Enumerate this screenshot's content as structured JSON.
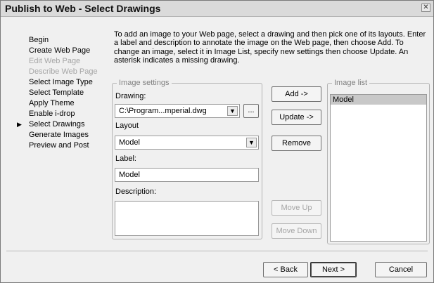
{
  "window": {
    "title": "Publish to Web - Select Drawings",
    "close_glyph": "✕"
  },
  "nav": {
    "current_marker": "▶",
    "items": [
      {
        "label": "Begin",
        "state": "enabled"
      },
      {
        "label": "Create Web Page",
        "state": "enabled"
      },
      {
        "label": "Edit Web Page",
        "state": "disabled"
      },
      {
        "label": "Describe Web Page",
        "state": "disabled"
      },
      {
        "label": "Select Image Type",
        "state": "enabled"
      },
      {
        "label": "Select Template",
        "state": "enabled"
      },
      {
        "label": "Apply Theme",
        "state": "enabled"
      },
      {
        "label": "Enable i-drop",
        "state": "enabled"
      },
      {
        "label": "Select Drawings",
        "state": "current"
      },
      {
        "label": "Generate Images",
        "state": "enabled"
      },
      {
        "label": "Preview and Post",
        "state": "enabled"
      }
    ]
  },
  "instructions": "To add an image to your Web page, select a drawing and then pick one of its layouts. Enter a label and description to annotate the image on the Web page, then choose Add. To change an image, select it in Image List, specify new settings then choose Update. An asterisk indicates a missing drawing.",
  "image_settings": {
    "legend": "Image settings",
    "drawing_label": "Drawing:",
    "drawing_value": "C:\\Program...mperial.dwg",
    "browse_label": "...",
    "layout_label": "Layout",
    "layout_value": "Model",
    "label_label": "Label:",
    "label_value": "Model",
    "description_label": "Description:",
    "description_value": ""
  },
  "actions": {
    "add": "Add ->",
    "update": "Update ->",
    "remove": "Remove",
    "move_up": "Move Up",
    "move_down": "Move Down"
  },
  "image_list": {
    "legend": "Image list",
    "items": [
      "Model"
    ]
  },
  "footer": {
    "back": "< Back",
    "next": "Next >",
    "cancel": "Cancel"
  },
  "icons": {
    "dropdown": "chevron-down-icon",
    "nav_current": "triangle-right-icon",
    "close": "close-icon"
  }
}
